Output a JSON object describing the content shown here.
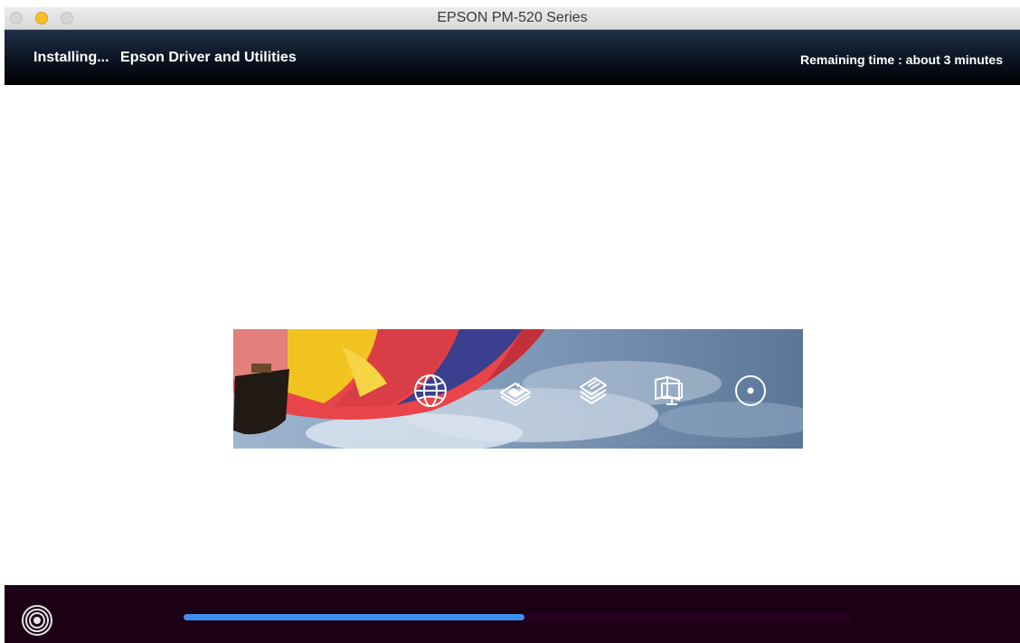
{
  "window": {
    "title": "EPSON PM-520 Series"
  },
  "header": {
    "status_prefix": "Installing...",
    "status_item": "Epson Driver and Utilities",
    "remaining_time": "Remaining time : about 3 minutes"
  },
  "banner": {
    "icons": [
      "globe-icon",
      "photo-icon",
      "documents-icon",
      "monitor-manual-icon",
      "disc-icon"
    ]
  },
  "footer": {
    "logo_icon": "concentric-rings-icon"
  },
  "progress": {
    "fraction": 0.51
  },
  "colors": {
    "header_bg": "#0b1422",
    "footer_bg": "#1b0016",
    "progress_fill": "#3f8ff2",
    "minimize_button": "#f5bf2a"
  }
}
